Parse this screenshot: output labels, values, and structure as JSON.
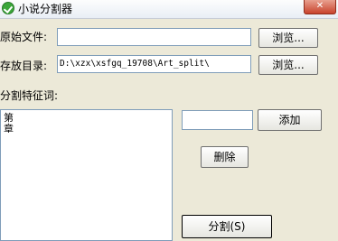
{
  "window": {
    "title": "小说分割器",
    "close_glyph": "✕"
  },
  "source_file": {
    "label": "原始文件:",
    "value": "",
    "browse_label": "浏览..."
  },
  "output_dir": {
    "label": "存放目录:",
    "value": "D:\\xzx\\xsfgq_19708\\Art_split\\",
    "browse_label": "浏览..."
  },
  "keywords": {
    "label": "分割特征词:",
    "items": [
      "第",
      "章"
    ],
    "new_value": "",
    "add_label": "添加",
    "delete_label": "删除",
    "split_label": "分割(S)"
  },
  "colors": {
    "accent": "#3aa63a",
    "close": "#c9432c"
  }
}
